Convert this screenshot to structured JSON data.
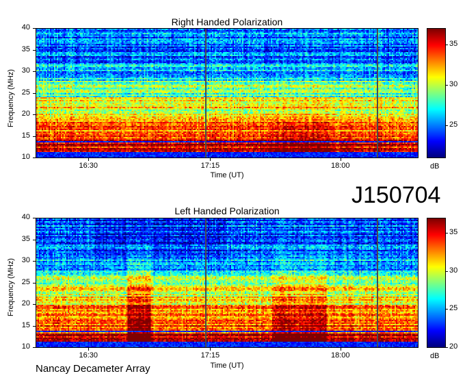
{
  "identifier": "J150704",
  "footer": "Nancay Decameter Array",
  "chart_data": [
    {
      "type": "heatmap",
      "title": "Right Handed Polarization",
      "xlabel": "Time (UT)",
      "ylabel": "Frequency (MHz)",
      "x_ticks": [
        "16:30",
        "17:15",
        "18:00"
      ],
      "y_ticks": [
        10,
        15,
        20,
        25,
        30,
        35,
        40
      ],
      "ylim": [
        10,
        40
      ],
      "colorbar": {
        "label": "dB",
        "ticks": [
          25,
          30,
          35
        ],
        "range": [
          21,
          37
        ],
        "colormap": "jet"
      }
    },
    {
      "type": "heatmap",
      "title": "Left Handed Polarization",
      "xlabel": "Time (UT)",
      "ylabel": "Frequency (MHz)",
      "x_ticks": [
        "16:30",
        "17:15",
        "18:00"
      ],
      "y_ticks": [
        10,
        15,
        20,
        25,
        30,
        35,
        40
      ],
      "ylim": [
        10,
        40
      ],
      "colorbar": {
        "label": "dB",
        "ticks": [
          20,
          25,
          30,
          35
        ],
        "range": [
          20,
          37
        ],
        "colormap": "jet"
      }
    }
  ]
}
